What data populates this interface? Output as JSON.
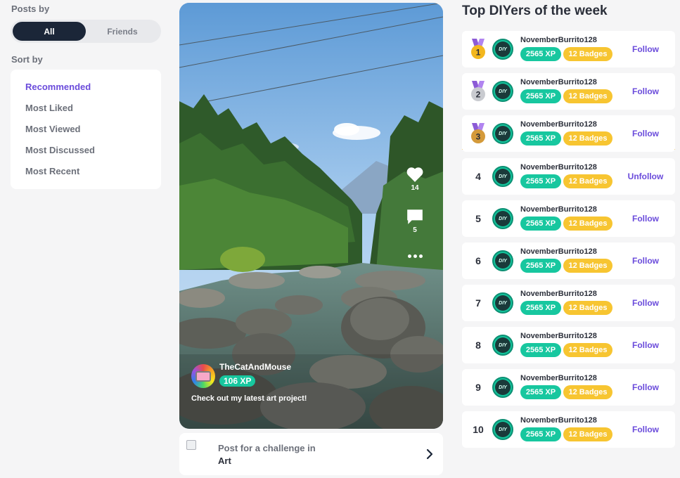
{
  "posts_by": {
    "label": "Posts by",
    "options": [
      "All",
      "Friends"
    ],
    "selected": "All"
  },
  "sort_by": {
    "label": "Sort by",
    "options": [
      "Recommended",
      "Most Liked",
      "Most Viewed",
      "Most Discussed",
      "Most Recent"
    ],
    "selected": "Recommended"
  },
  "post": {
    "author_name": "TheCatAndMouse",
    "author_xp": "106 XP",
    "caption": "Check out my latest art project!",
    "likes": "14",
    "comments": "5"
  },
  "challenge": {
    "line1": "Post for a challenge in",
    "line2": "Art"
  },
  "leaderboard": {
    "title": "Top DIYers of the week",
    "avatar_text": "DIY",
    "rows": [
      {
        "rank": "1",
        "name": "NovemberBurrito128",
        "xp": "2565 XP",
        "badges": "12 Badges",
        "action": "Follow",
        "medal": "gold"
      },
      {
        "rank": "2",
        "name": "NovemberBurrito128",
        "xp": "2565 XP",
        "badges": "12 Badges",
        "action": "Follow",
        "medal": "silver"
      },
      {
        "rank": "3",
        "name": "NovemberBurrito128",
        "xp": "2565 XP",
        "badges": "12 Badges",
        "action": "Follow",
        "medal": "bronze"
      },
      {
        "rank": "4",
        "name": "NovemberBurrito128",
        "xp": "2565 XP",
        "badges": "12 Badges",
        "action": "Unfollow"
      },
      {
        "rank": "5",
        "name": "NovemberBurrito128",
        "xp": "2565 XP",
        "badges": "12 Badges",
        "action": "Follow"
      },
      {
        "rank": "6",
        "name": "NovemberBurrito128",
        "xp": "2565 XP",
        "badges": "12 Badges",
        "action": "Follow"
      },
      {
        "rank": "7",
        "name": "NovemberBurrito128",
        "xp": "2565 XP",
        "badges": "12 Badges",
        "action": "Follow"
      },
      {
        "rank": "8",
        "name": "NovemberBurrito128",
        "xp": "2565 XP",
        "badges": "12 Badges",
        "action": "Follow"
      },
      {
        "rank": "9",
        "name": "NovemberBurrito128",
        "xp": "2565 XP",
        "badges": "12 Badges",
        "action": "Follow"
      },
      {
        "rank": "10",
        "name": "NovemberBurrito128",
        "xp": "2565 XP",
        "badges": "12 Badges",
        "action": "Follow"
      }
    ]
  },
  "colors": {
    "accent": "#6a4bdb",
    "xp_green": "#17c79f",
    "badge_yellow": "#f7c531",
    "dark_toggle": "#1b2638"
  },
  "icons": [
    "heart-icon",
    "comment-icon",
    "more-icon",
    "chevron-right-icon",
    "medal-icon",
    "diy-avatar"
  ]
}
